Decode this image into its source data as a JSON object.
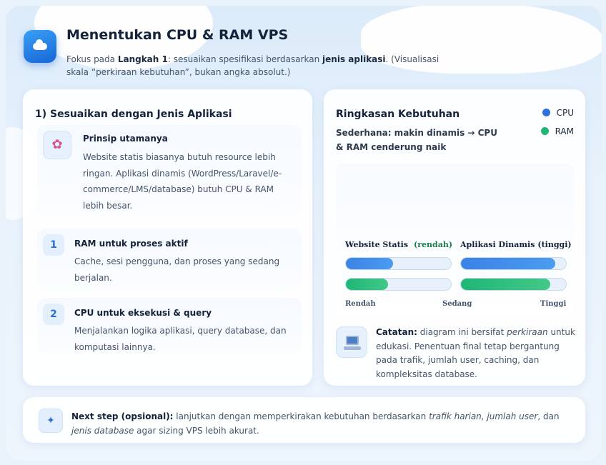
{
  "header": {
    "title": "Menentukan CPU & RAM VPS",
    "subtitle_prefix": "Fokus pada ",
    "subtitle_step": "Langkah 1",
    "subtitle_mid": ": sesuaikan spesifikasi berdasarkan ",
    "subtitle_bold": "jenis aplikasi",
    "subtitle_suffix": ". (Visualisasi skala “perkiraan kebutuhan”, bukan angka absolut.)",
    "icon": "cloud-icon"
  },
  "left": {
    "title": "1) Sesuaikan dengan Jenis Aplikasi",
    "principle": {
      "icon": "brain-icon",
      "title": "Prinsip utamanya",
      "text": "Website statis biasanya butuh resource lebih ringan. Aplikasi dinamis (WordPress/Laravel/e-commerce/LMS/database) butuh CPU & RAM lebih besar."
    },
    "items": [
      {
        "num": "1",
        "title": "RAM untuk proses aktif",
        "text": "Cache, sesi pengguna, dan proses yang sedang berjalan."
      },
      {
        "num": "2",
        "title": "CPU untuk eksekusi & query",
        "text": "Menjalankan logika aplikasi, query database, dan komputasi lainnya."
      }
    ]
  },
  "right": {
    "title": "Ringkasan Kebutuhan",
    "subtitle": "Sederhana: makin dinamis → CPU & RAM cenderung naik",
    "legend": [
      {
        "label": "CPU",
        "color": "#2f6fde"
      },
      {
        "label": "RAM",
        "color": "#1fb676"
      }
    ],
    "note_label": "Catatan:",
    "note_pre": " diagram ini bersifat ",
    "note_em": "perkiraan",
    "note_post": " untuk edukasi. Penentuan final tetap bergantung pada trafik, jumlah user, caching, dan kompleksitas database.",
    "note_icon": "laptop-icon"
  },
  "chart_data": {
    "type": "bar",
    "categories": [
      "Website Statis",
      "Aplikasi Dinamis"
    ],
    "category_hints": [
      "(rendah)",
      "(tinggi)"
    ],
    "series": [
      {
        "name": "CPU",
        "values": [
          0.45,
          0.9
        ]
      },
      {
        "name": "RAM",
        "values": [
          0.4,
          0.85
        ]
      }
    ],
    "scale_labels": [
      "Rendah",
      "Sedang",
      "Tinggi"
    ],
    "ylim": [
      0,
      1
    ]
  },
  "next": {
    "icon": "sparkle-icon",
    "label": "Next step (opsional):",
    "pre": " lanjutkan dengan memperkirakan kebutuhan berdasarkan ",
    "em1": "trafik harian, jumlah user",
    "mid": ", dan ",
    "em2": "jenis database",
    "post": " agar sizing VPS lebih akurat."
  }
}
